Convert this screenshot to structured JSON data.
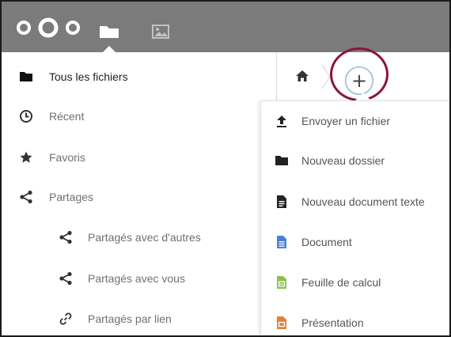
{
  "header": {
    "logo_icon": "nextcloud-logo",
    "apps": [
      {
        "name": "files",
        "icon": "folder-icon",
        "active": true
      },
      {
        "name": "gallery",
        "icon": "image-icon",
        "active": false
      }
    ],
    "background_color": "#7b7b7b"
  },
  "sidebar": {
    "items": [
      {
        "label": "Tous les fichiers",
        "icon": "folder-icon",
        "active": true
      },
      {
        "label": "Récent",
        "icon": "clock-icon"
      },
      {
        "label": "Favoris",
        "icon": "star-icon"
      },
      {
        "label": "Partages",
        "icon": "share-icon"
      },
      {
        "label": "Partagés avec d'autres",
        "icon": "share-icon"
      },
      {
        "label": "Partagés avec vous",
        "icon": "share-icon"
      },
      {
        "label": "Partagés par lien",
        "icon": "link-icon"
      }
    ]
  },
  "breadcrumb": {
    "home_icon": "home-icon",
    "add_button_label": "+"
  },
  "new_menu": {
    "items": [
      {
        "label": "Envoyer un fichier",
        "icon": "upload-icon"
      },
      {
        "label": "Nouveau dossier",
        "icon": "folder-icon"
      },
      {
        "label": "Nouveau document texte",
        "icon": "text-document-icon"
      },
      {
        "label": "Document",
        "icon": "document-icon",
        "color": "#4a82d6"
      },
      {
        "label": "Feuille de calcul",
        "icon": "spreadsheet-icon",
        "color": "#8bc34a"
      },
      {
        "label": "Présentation",
        "icon": "presentation-icon",
        "color": "#e57f3a"
      }
    ]
  },
  "highlight_color": "#8a1538"
}
